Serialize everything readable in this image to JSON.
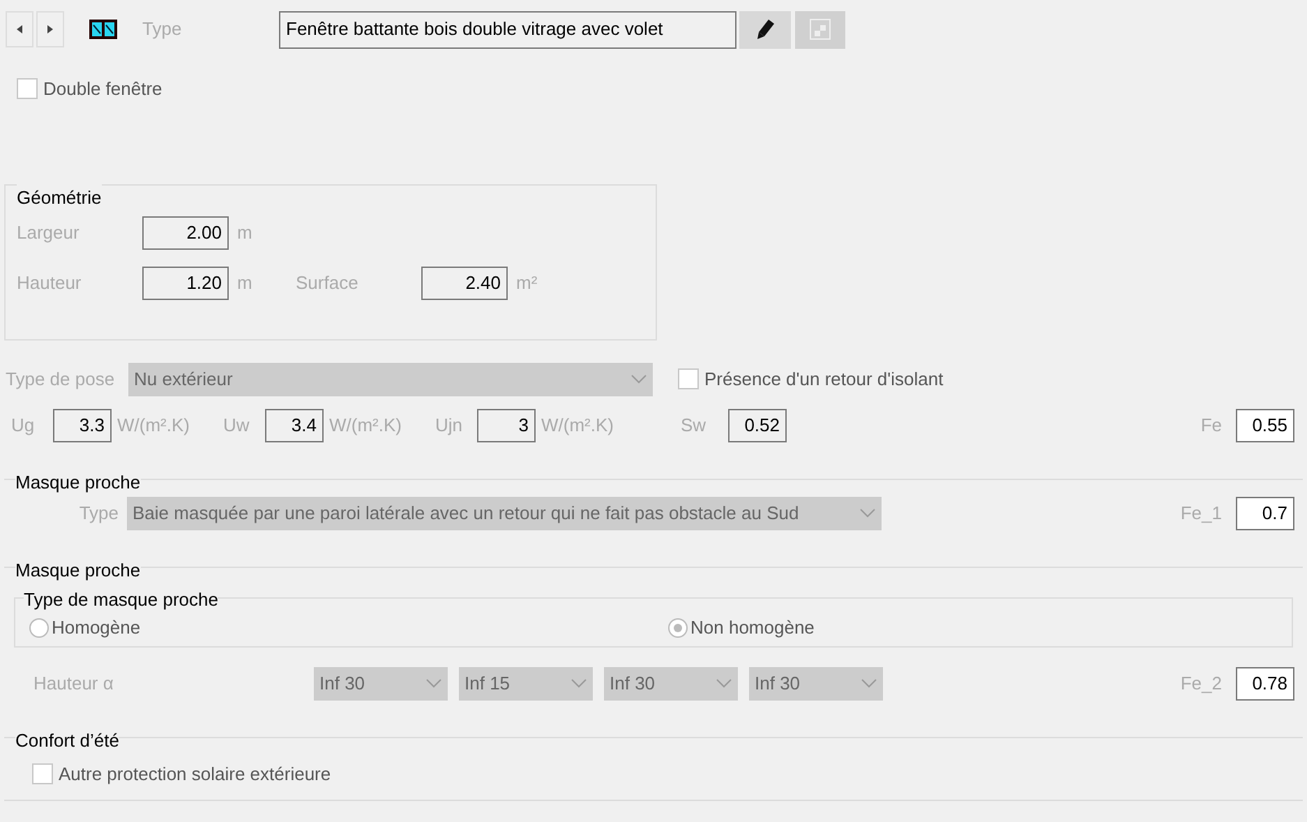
{
  "header": {
    "type_label": "Type",
    "type_value": "Fenêtre battante bois double vitrage avec volet",
    "double_window": {
      "label": "Double fenêtre",
      "checked": false
    }
  },
  "geometry": {
    "title": "Géométrie",
    "rows": [
      [
        {
          "label": "Largeur",
          "value": "2.00",
          "unit": "m"
        }
      ],
      [
        {
          "label": "Hauteur",
          "value": "1.20",
          "unit": "m"
        },
        {
          "label": "Surface",
          "value": "2.40",
          "unit": "m²"
        }
      ]
    ]
  },
  "pose": {
    "label": "Type de pose",
    "value": "Nu extérieur",
    "insulation_return": {
      "label": "Présence d'un retour d'isolant",
      "checked": false
    }
  },
  "coefficients": [
    {
      "label": "Ug",
      "value": "3.3",
      "unit": "W/(m².K)"
    },
    {
      "label": "Uw",
      "value": "3.4",
      "unit": "W/(m².K)"
    },
    {
      "label": "Ujn",
      "value": "3",
      "unit": "W/(m².K)"
    },
    {
      "label": "Sw",
      "value": "0.52"
    }
  ],
  "fe": {
    "label": "Fe",
    "value": "0.55"
  },
  "mask_1": {
    "title": "Masque proche",
    "type_label": "Type",
    "type_value": "Baie masquée par une paroi latérale avec un retour qui ne fait pas obstacle au Sud",
    "fe_label": "Fe_1",
    "fe_value": "0.7"
  },
  "mask_2": {
    "title": "Masque proche",
    "group_title": "Type de masque proche",
    "options": [
      {
        "label": "Homogène",
        "selected": false
      },
      {
        "label": "Non homogène",
        "selected": true
      }
    ],
    "height_label": "Hauteur α",
    "dropdowns": [
      "Inf 30",
      "Inf 15",
      "Inf 30",
      "Inf 30"
    ],
    "fe_label": "Fe_2",
    "fe_value": "0.78"
  },
  "summer": {
    "title": "Confort d’été",
    "option": {
      "label": "Autre protection solaire extérieure",
      "checked": false
    }
  }
}
